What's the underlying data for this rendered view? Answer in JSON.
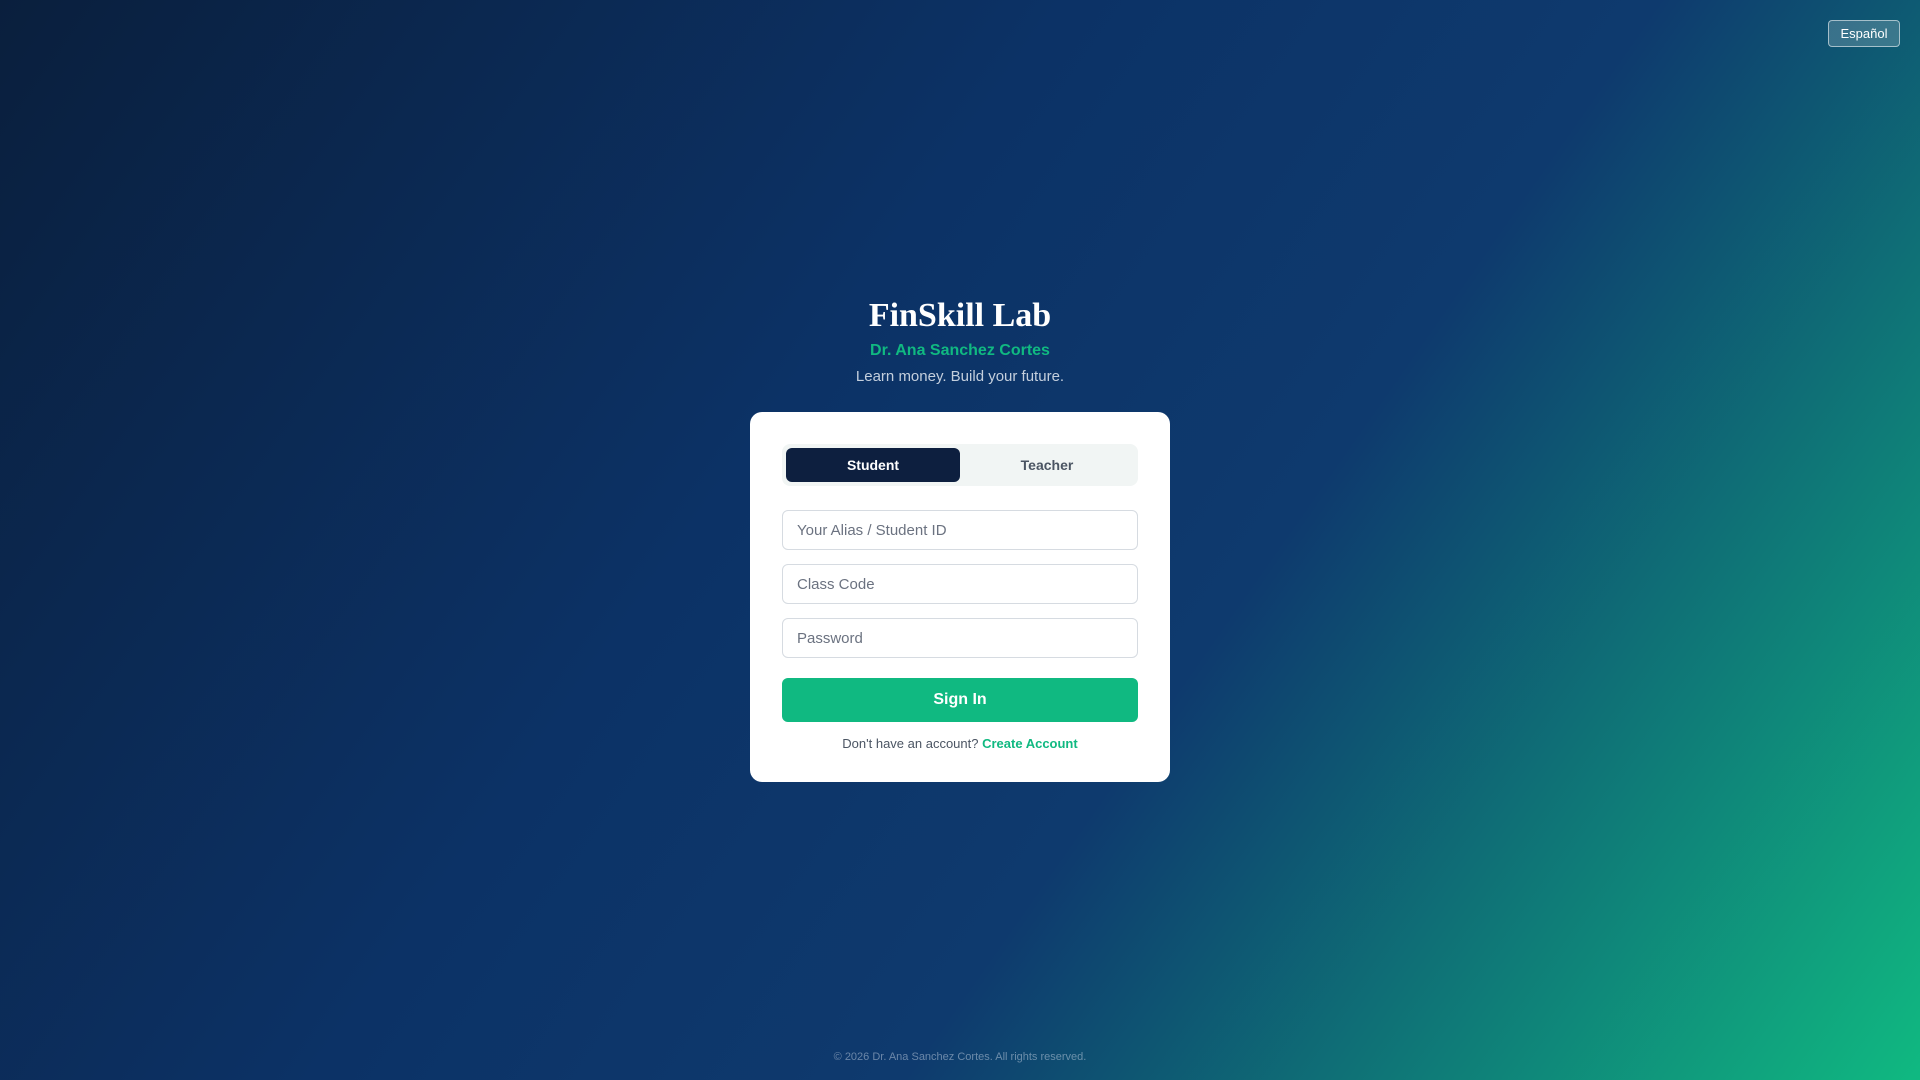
{
  "language_toggle": {
    "label": "Español"
  },
  "header": {
    "title": "FinSkill Lab",
    "subtitle": "Dr. Ana Sanchez Cortes",
    "tagline": "Learn money. Build your future."
  },
  "login_card": {
    "role_tabs": [
      {
        "label": "Student",
        "active": true
      },
      {
        "label": "Teacher",
        "active": false
      }
    ],
    "fields": {
      "alias": {
        "placeholder": "Your Alias / Student ID",
        "value": ""
      },
      "class_code": {
        "placeholder": "Class Code",
        "value": ""
      },
      "password": {
        "placeholder": "Password",
        "value": ""
      }
    },
    "sign_in_label": "Sign In",
    "account_prompt": "Don't have an account?",
    "create_account_label": "Create Account"
  },
  "footer": {
    "copyright": "© 2026 Dr. Ana Sanchez Cortes. All rights reserved."
  },
  "colors": {
    "accent": "#10b981",
    "navy": "#0d1f3f",
    "card_background": "#ffffff"
  }
}
